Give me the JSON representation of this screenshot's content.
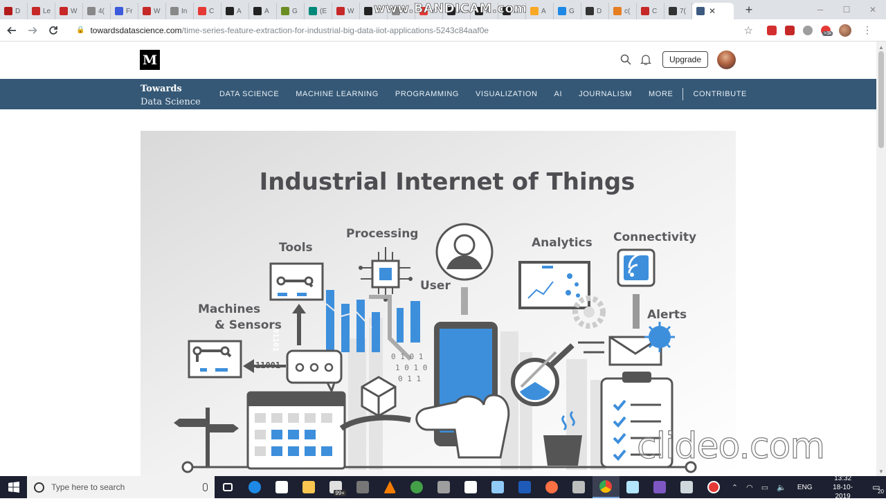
{
  "browser": {
    "tabs": [
      {
        "label": "D",
        "color": "#b31b1b"
      },
      {
        "label": "Le",
        "color": "#c62828"
      },
      {
        "label": "W",
        "color": "#c62828"
      },
      {
        "label": "4(",
        "color": "#888888"
      },
      {
        "label": "Fr",
        "color": "#3b5bdb"
      },
      {
        "label": "W",
        "color": "#c62828"
      },
      {
        "label": "In",
        "color": "#888888"
      },
      {
        "label": "C",
        "color": "#e53935"
      },
      {
        "label": "A",
        "color": "#222222"
      },
      {
        "label": "A",
        "color": "#222222"
      },
      {
        "label": "G",
        "color": "#6b8e23"
      },
      {
        "label": "(E",
        "color": "#00897b"
      },
      {
        "label": "W",
        "color": "#c62828"
      },
      {
        "label": "A",
        "color": "#222222"
      },
      {
        "label": "C",
        "color": "#888888"
      },
      {
        "label": "Y",
        "color": "#e53935"
      },
      {
        "label": "A",
        "color": "#222222"
      },
      {
        "label": "A",
        "color": "#222222"
      },
      {
        "label": "A",
        "color": "#222222"
      },
      {
        "label": "A",
        "color": "#f9a825"
      },
      {
        "label": "G",
        "color": "#1e88e5"
      },
      {
        "label": "D",
        "color": "#333333"
      },
      {
        "label": "c(",
        "color": "#e67e22"
      },
      {
        "label": "C",
        "color": "#c62828"
      },
      {
        "label": "7(",
        "color": "#333333"
      }
    ],
    "active_tab_color": "#3d5a80",
    "watermark_top": "www.BANDICAM.com",
    "url_host": "towardsdatascience.com",
    "url_path": "/time-series-feature-extraction-for-industrial-big-data-iiot-applications-5243c84aaf0e",
    "extension_badge": ">3k"
  },
  "medium": {
    "logo": "M",
    "upgrade_label": "Upgrade"
  },
  "tds": {
    "brand_line1": "Towards",
    "brand_line2": "Data Science",
    "nav": [
      "DATA SCIENCE",
      "MACHINE LEARNING",
      "PROGRAMMING",
      "VISUALIZATION",
      "AI",
      "JOURNALISM",
      "MORE",
      "CONTRIBUTE"
    ]
  },
  "hero": {
    "title": "Industrial Internet of Things",
    "labels": {
      "tools": "Tools",
      "processing": "Processing",
      "user": "User",
      "analytics": "Analytics",
      "connectivity": "Connectivity",
      "alerts": "Alerts",
      "machines_1": "Machines",
      "machines_2": "& Sensors",
      "binary_arrow": "11001",
      "binary_vertical": "01101"
    },
    "accent": "#3d8fdc"
  },
  "watermark_bottom": "clideo.com",
  "taskbar": {
    "search_placeholder": "Type here to search",
    "store_badge": "99+",
    "lang": "ENG",
    "time": "13:32",
    "date": "18-10-2019",
    "notifications": "20"
  }
}
